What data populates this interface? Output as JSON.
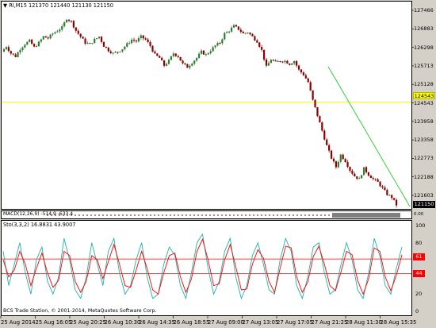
{
  "chart_header": {
    "symbol_label": "RI,M15",
    "ohlc_values": "121370 121440 121130 121150",
    "arrow_glyph": "▼"
  },
  "price_axis": {
    "ticks": [
      "127466",
      "126883",
      "126298",
      "125713",
      "125128",
      "124543",
      "123958",
      "123358",
      "122773",
      "122188",
      "121603"
    ],
    "yellow_level_label": "124543",
    "current_price_label": "121150"
  },
  "macd": {
    "label": "MACD(12,26,9) -514.9 -633.4",
    "right_label": "0.00"
  },
  "stochastic": {
    "label": "Sto(3,3,2) 16.8831 43.9007",
    "axis_ticks": [
      "100",
      "80",
      "61",
      "44",
      "20",
      "0"
    ],
    "level_upper_label": "61",
    "level_lower_label": "44"
  },
  "time_axis": {
    "labels": [
      "25 Aug 2014",
      "25 Aug 16:05",
      "25 Aug 20:25",
      "26 Aug 10:30",
      "26 Aug 14:35",
      "26 Aug 18:55",
      "27 Aug 09:00",
      "27 Aug 13:05",
      "27 Aug 17:05",
      "27 Aug 21:25",
      "28 Aug 11:30",
      "28 Aug 15:35"
    ]
  },
  "watermark": "BCS Trade Station, © 2001-2014, MetaQuotes Software Corp.",
  "colors": {
    "bull_candle": "#2e7d32",
    "bear_candle": "#8b0000",
    "trendline": "#32cd32",
    "level_line": "#ffff00",
    "sto_main": "#20b2aa",
    "sto_signal": "#ff0000",
    "sto_level": "#ff0000"
  },
  "chart_data": [
    {
      "type": "candlestick",
      "title": "RI,M15",
      "ylim": [
        121150,
        127700
      ],
      "close_path": [
        126200,
        126380,
        126150,
        126050,
        126300,
        126460,
        126560,
        126350,
        126500,
        126700,
        126650,
        126800,
        126900,
        127000,
        127300,
        127200,
        126900,
        126700,
        126500,
        126450,
        126600,
        126700,
        126400,
        126250,
        126150,
        126200,
        126300,
        126450,
        126600,
        126550,
        126700,
        126600,
        126400,
        126100,
        126000,
        125750,
        125900,
        126150,
        126050,
        125800,
        125700,
        125850,
        126000,
        126200,
        126100,
        126250,
        126400,
        126500,
        126800,
        126900,
        127050,
        126950,
        126800,
        126850,
        126700,
        126550,
        126250,
        125700,
        125950,
        125850,
        125900,
        125900,
        125800,
        125900,
        125600,
        125450,
        125200,
        124600,
        124100,
        123600,
        123100,
        122700,
        122400,
        122800,
        122600,
        122300,
        122100,
        122000,
        122350,
        122150,
        122000,
        121900,
        121700,
        121500,
        121400,
        121150
      ],
      "trendline": {
        "from": 125713,
        "to": 121150
      },
      "horizontal_level": 124543,
      "current_price": 121150
    },
    {
      "type": "line",
      "title": "Sto(3,3,2)",
      "series": [
        {
          "name": "main",
          "values": [
            70,
            30,
            55,
            80,
            45,
            20,
            60,
            75,
            35,
            20,
            40,
            85,
            60,
            25,
            15,
            40,
            80,
            55,
            30,
            70,
            85,
            45,
            20,
            30,
            60,
            80,
            40,
            15,
            20,
            55,
            75,
            65,
            30,
            15,
            45,
            80,
            90,
            50,
            20,
            35,
            70,
            85,
            40,
            15,
            30,
            65,
            80,
            55,
            25,
            20,
            60,
            85,
            70,
            30,
            15,
            40,
            75,
            80,
            45,
            20,
            25,
            55,
            80,
            60,
            25,
            15,
            45,
            85,
            65,
            30,
            20,
            50,
            75
          ]
        },
        {
          "name": "signal",
          "values": [
            60,
            40,
            48,
            70,
            55,
            30,
            50,
            68,
            45,
            28,
            36,
            70,
            65,
            35,
            22,
            35,
            65,
            60,
            38,
            58,
            78,
            55,
            30,
            28,
            48,
            70,
            50,
            25,
            20,
            45,
            65,
            68,
            40,
            22,
            38,
            70,
            84,
            60,
            30,
            32,
            60,
            78,
            52,
            25,
            26,
            55,
            72,
            62,
            35,
            22,
            50,
            76,
            74,
            40,
            22,
            34,
            64,
            76,
            55,
            30,
            24,
            46,
            70,
            66,
            36,
            20,
            38,
            74,
            70,
            40,
            24,
            42,
            66
          ]
        }
      ],
      "ylim": [
        0,
        100
      ],
      "levels": [
        61,
        44
      ]
    }
  ]
}
